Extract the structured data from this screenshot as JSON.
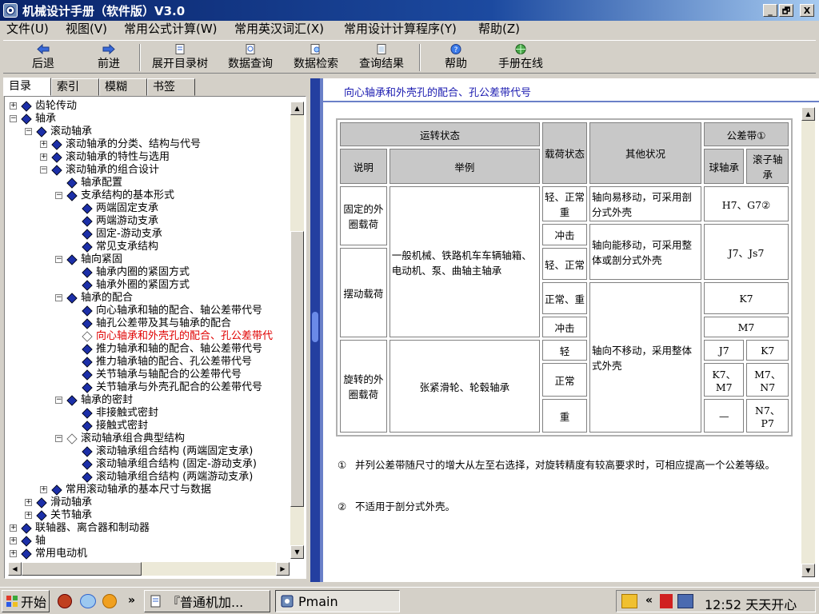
{
  "window": {
    "title": "机械设计手册（软件版）V3.0",
    "controls": [
      "_",
      "🗗",
      "X"
    ]
  },
  "menu": [
    "文件(U)",
    "视图(V)",
    "常用公式计算(W)",
    "常用英汉词汇(X)",
    "常用设计计算程序(Y)",
    "帮助(Z)"
  ],
  "toolbar": [
    "后退",
    "前进",
    "展开目录树",
    "数据查询",
    "数据检索",
    "查询结果",
    "帮助",
    "手册在线"
  ],
  "left_tabs": [
    "目录",
    "索引",
    "模糊",
    "书签"
  ],
  "tree": [
    {
      "label": "齿轮传动",
      "level": 0,
      "state": "collapsed"
    },
    {
      "label": "轴承",
      "level": 0,
      "state": "expanded"
    },
    {
      "label": "滚动轴承",
      "level": 1,
      "state": "expanded"
    },
    {
      "label": "滚动轴承的分类、结构与代号",
      "level": 2,
      "state": "collapsed"
    },
    {
      "label": "滚动轴承的特性与选用",
      "level": 2,
      "state": "collapsed"
    },
    {
      "label": "滚动轴承的组合设计",
      "level": 2,
      "state": "expanded"
    },
    {
      "label": "轴承配置",
      "level": 3,
      "state": "leaf"
    },
    {
      "label": "支承结构的基本形式",
      "level": 3,
      "state": "expanded"
    },
    {
      "label": "两端固定支承",
      "level": 4,
      "state": "leaf"
    },
    {
      "label": "两端游动支承",
      "level": 4,
      "state": "leaf"
    },
    {
      "label": "固定-游动支承",
      "level": 4,
      "state": "leaf"
    },
    {
      "label": "常见支承结构",
      "level": 4,
      "state": "leaf"
    },
    {
      "label": "轴向紧固",
      "level": 3,
      "state": "expanded"
    },
    {
      "label": "轴承内圈的紧固方式",
      "level": 4,
      "state": "leaf"
    },
    {
      "label": "轴承外圈的紧固方式",
      "level": 4,
      "state": "leaf"
    },
    {
      "label": "轴承的配合",
      "level": 3,
      "state": "expanded"
    },
    {
      "label": "向心轴承和轴的配合、轴公差带代号",
      "level": 4,
      "state": "leaf"
    },
    {
      "label": "轴孔公差带及其与轴承的配合",
      "level": 4,
      "state": "leaf"
    },
    {
      "label": "向心轴承和外壳孔的配合、孔公差带代",
      "level": 4,
      "state": "selected"
    },
    {
      "label": "推力轴承和轴的配合、轴公差带代号",
      "level": 4,
      "state": "leaf"
    },
    {
      "label": "推力轴承轴的配合、孔公差带代号",
      "level": 4,
      "state": "leaf"
    },
    {
      "label": "关节轴承与轴配合的公差带代号",
      "level": 4,
      "state": "leaf"
    },
    {
      "label": "关节轴承与外壳孔配合的公差带代号",
      "level": 4,
      "state": "leaf"
    },
    {
      "label": "轴承的密封",
      "level": 3,
      "state": "expanded"
    },
    {
      "label": "非接触式密封",
      "level": 4,
      "state": "leaf"
    },
    {
      "label": "接触式密封",
      "level": 4,
      "state": "leaf"
    },
    {
      "label": "滚动轴承组合典型结构",
      "level": 3,
      "state": "expanded-open"
    },
    {
      "label": "滚动轴承组合结构 (两端固定支承)",
      "level": 4,
      "state": "leaf"
    },
    {
      "label": "滚动轴承组合结构 (固定-游动支承)",
      "level": 4,
      "state": "leaf"
    },
    {
      "label": "滚动轴承组合结构 (两端游动支承)",
      "level": 4,
      "state": "leaf"
    },
    {
      "label": "常用滚动轴承的基本尺寸与数据",
      "level": 2,
      "state": "collapsed"
    },
    {
      "label": "滑动轴承",
      "level": 1,
      "state": "collapsed"
    },
    {
      "label": "关节轴承",
      "level": 1,
      "state": "collapsed"
    },
    {
      "label": "联轴器、离合器和制动器",
      "level": 0,
      "state": "collapsed"
    },
    {
      "label": "轴",
      "level": 0,
      "state": "collapsed"
    },
    {
      "label": "常用电动机",
      "level": 0,
      "state": "collapsed"
    }
  ],
  "content": {
    "heading": "向心轴承和外壳孔的配合、孔公差带代号",
    "table": {
      "h_run": "运转状态",
      "h_load": "载荷状态",
      "h_other": "其他状况",
      "h_tol": "公差带①",
      "h_desc": "说明",
      "h_example": "举例",
      "h_ball": "球轴承",
      "h_roller": "滚子轴承",
      "r_fixed": "固定的外圈载荷",
      "r_swing": "摆动载荷",
      "r_rot": "旋转的外圈载荷",
      "ex_general": "一般机械、铁路机车车辆轴箱、电动机、泵、曲轴主轴承",
      "ex_tension": "张紧滑轮、轮毂轴承",
      "load_1": "轻、正常重",
      "load_2": "冲击",
      "load_3": "轻、正常",
      "load_4": "正常、重",
      "load_5": "冲击",
      "load_6": "轻",
      "load_7": "正常",
      "load_8": "重",
      "other_1": "轴向易移动，可采用剖分式外壳",
      "other_2": "轴向能移动，可采用整体或剖分式外壳",
      "other_3": "轴向不移动，采用整体式外壳",
      "tol_1": "H7、G7②",
      "tol_2": "J7、Js7",
      "tol_3": "K7",
      "tol_4": "M7",
      "tol_5a": "J7",
      "tol_5b": "K7",
      "tol_6a": "K7、M7",
      "tol_6b": "M7、N7",
      "tol_7a": "—",
      "tol_7b": "N7、P7"
    },
    "notes": [
      {
        "num": "①",
        "text": "并列公差带随尺寸的增大从左至右选择，对旋转精度有较高要求时，可相应提高一个公差等级。"
      },
      {
        "num": "②",
        "text": "不适用于剖分式外壳。"
      }
    ]
  },
  "taskbar": {
    "start": "开始",
    "task1": "『普通机加...",
    "task2": "Pmain",
    "time": "12:52 天天开心"
  },
  "colors": {
    "title_start": "#0a246a",
    "title_end": "#a6caf0",
    "tree_icon": "#1c2fa8",
    "selected_text": "#e00000",
    "heading_text": "#1a1ab0",
    "splitter": "#243fa0"
  }
}
